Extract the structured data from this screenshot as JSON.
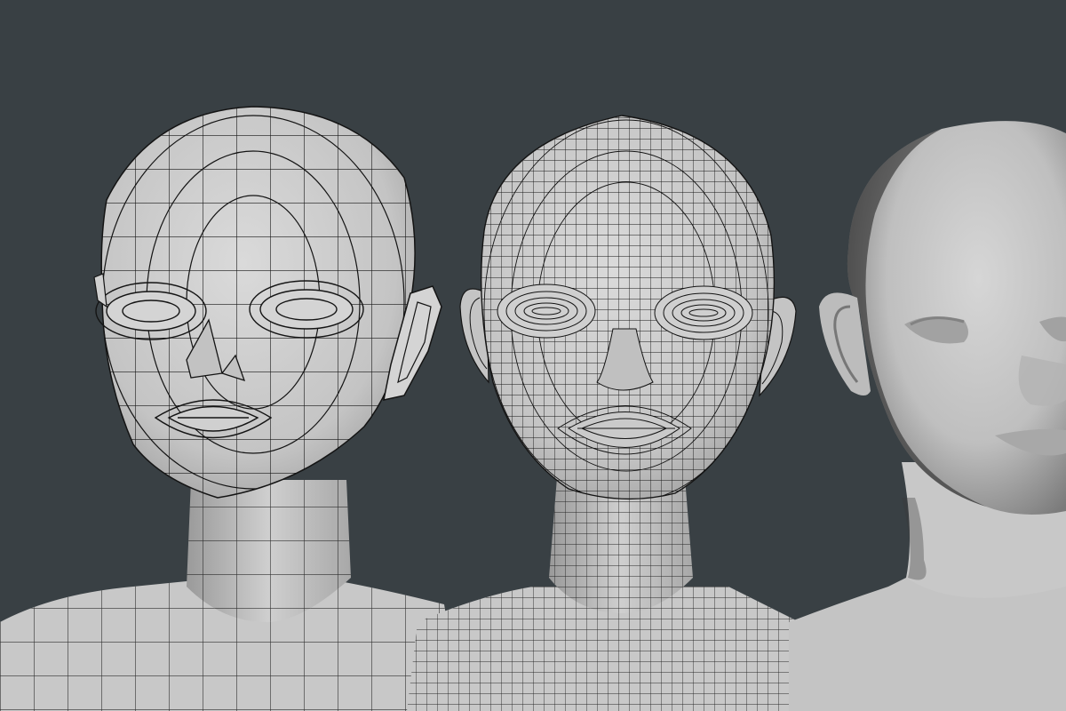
{
  "scene": {
    "background_color": "#394044",
    "mesh_surface_color": "#c9c9c9",
    "wire_color": "#141414"
  },
  "figures": [
    {
      "name": "low-poly-wireframe-head",
      "mesh_density": "low"
    },
    {
      "name": "high-poly-wireframe-head",
      "mesh_density": "high"
    },
    {
      "name": "smooth-shaded-head",
      "mesh_density": "none"
    }
  ]
}
